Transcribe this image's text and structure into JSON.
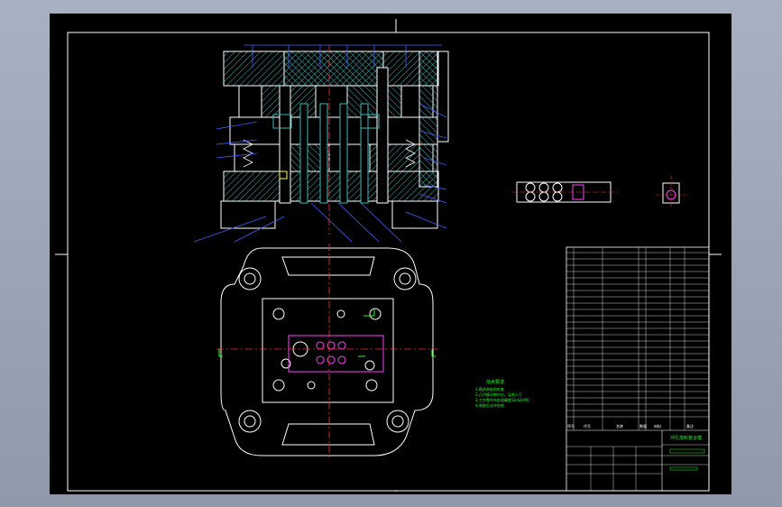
{
  "title_block": {
    "drawing_title": "冲孔落料复合模",
    "header_row": [
      "序号",
      "代号",
      "名称",
      "数量",
      "材料",
      "备注"
    ]
  },
  "tech_requirements": {
    "heading": "技术要求",
    "items": [
      "1.模具装配前检查",
      "2.凸凹模间隙均匀，误差小于",
      "3.工作零件热处理硬度58-62HRC",
      "4.装配后试冲合格"
    ]
  },
  "colors": {
    "background": "#000000",
    "frame": "#ffffff",
    "hatch": "#3fb8b8",
    "centerline": "#ff3030",
    "leader": "#4060ff",
    "magenta": "#ff40ff",
    "green": "#20ff20",
    "yellow": "#ffff40"
  }
}
